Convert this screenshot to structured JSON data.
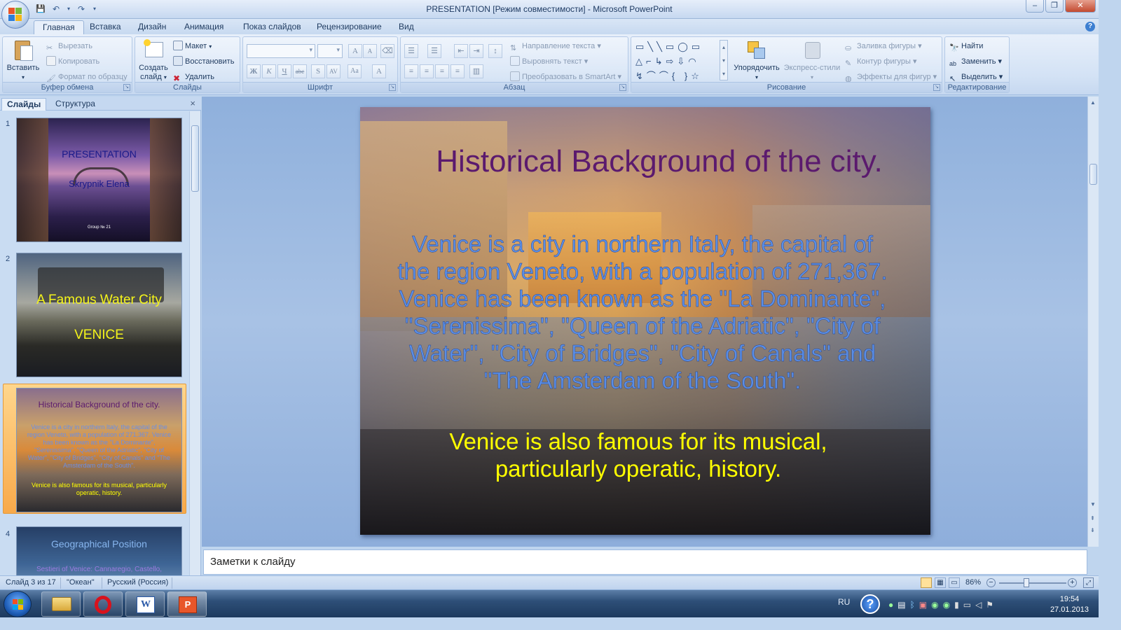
{
  "window": {
    "title": "PRESENTATION [Режим совместимости] - Microsoft PowerPoint"
  },
  "ribbon_tabs": [
    "Главная",
    "Вставка",
    "Дизайн",
    "Анимация",
    "Показ слайдов",
    "Рецензирование",
    "Вид"
  ],
  "active_tab": "Главная",
  "clipboard": {
    "paste": "Вставить",
    "cut": "Вырезать",
    "copy": "Копировать",
    "format_painter": "Формат по образцу",
    "label": "Буфер обмена"
  },
  "slides_group": {
    "new_slide": "Создать слайд",
    "layout": "Макет",
    "reset": "Восстановить",
    "delete": "Удалить",
    "label": "Слайды"
  },
  "font_group": {
    "label": "Шрифт"
  },
  "paragraph_group": {
    "text_direction": "Направление текста",
    "align_text": "Выровнять текст",
    "smartart": "Преобразовать в SmartArt",
    "label": "Абзац"
  },
  "drawing_group": {
    "arrange": "Упорядочить",
    "quick_styles": "Экспресс-стили",
    "shape_fill": "Заливка фигуры",
    "shape_outline": "Контур фигуры",
    "shape_effects": "Эффекты для фигур",
    "label": "Рисование"
  },
  "editing_group": {
    "find": "Найти",
    "replace": "Заменить",
    "select": "Выделить",
    "label": "Редактирование"
  },
  "pane_tabs": {
    "slides": "Слайды",
    "outline": "Структура"
  },
  "thumbnails": [
    {
      "num": "1",
      "title": "PRESENTATION",
      "subtitle": "Skrypnik Elena",
      "footer": "Group № 21"
    },
    {
      "num": "2",
      "title": "A Famous Water City",
      "subtitle": "VENICE"
    },
    {
      "num": "3",
      "title": "Historical Background of the city.",
      "body": "Venice is a city in northern Italy, the capital of the region Veneto, with a population of 271,367. Venice has been known as the \"La Dominante\", \"Serenissima\", \"Queen of the Adriatic\", \"City of Water\", \"City of Bridges\", \"City of Canals\" and \"The Amsterdam of the South\".",
      "body2": "Venice is also famous for its musical, particularly operatic, history."
    },
    {
      "num": "4",
      "title": "Geographical Position",
      "body": "Sestieri of Venice: Cannaregio, Castello,"
    }
  ],
  "current_slide": {
    "title": "Historical Background of the city.",
    "body": "Venice is a city in northern Italy, the capital of the region Veneto, with a population of 271,367. Venice has been known as the \"La Dominante\", \"Serenissima\", \"Queen of the Adriatic\", \"City of Water\", \"City of Bridges\", \"City of Canals\" and \"The Amsterdam of the South\".",
    "body2": "Venice is also famous for its musical, particularly operatic, history."
  },
  "notes_placeholder": "Заметки к слайду",
  "status": {
    "slide_of": "Слайд 3 из 17",
    "theme": "\"Океан\"",
    "language": "Русский (Россия)",
    "zoom": "86%"
  },
  "taskbar": {
    "lang": "RU",
    "time": "19:54",
    "date": "27.01.2013"
  },
  "colors": {
    "title_purple": "#5b1a6e",
    "body_blue": "#5a8ee6",
    "body_yellow": "#ffff00",
    "selection_orange": "#f8a94a"
  }
}
